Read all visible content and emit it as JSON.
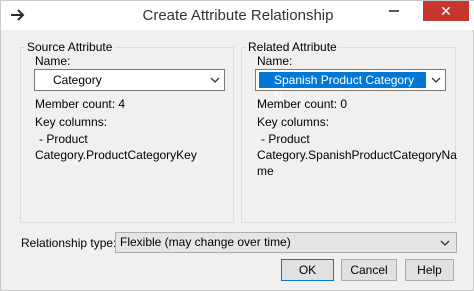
{
  "window": {
    "title": "Create Attribute Relationship",
    "close_glyph": "✕"
  },
  "source": {
    "group_label": "Source Attribute",
    "name_label": "Name:",
    "name_value": "Category",
    "member_count": "Member count: 4",
    "key_columns_label": "Key columns:",
    "key_line1": "- Product",
    "key_line2": "Category.ProductCategoryKey"
  },
  "related": {
    "group_label": "Related Attribute",
    "name_label": "Name:",
    "name_value": "Spanish Product Category N...",
    "member_count": "Member count: 0",
    "key_columns_label": "Key columns:",
    "key_line1": "- Product",
    "key_line2": "Category.SpanishProductCategoryNa",
    "key_line3": "me"
  },
  "relationship": {
    "label": "Relationship type:",
    "value": "Flexible (may change over time)"
  },
  "buttons": {
    "ok": "OK",
    "cancel": "Cancel",
    "help": "Help"
  },
  "colors": {
    "accent": "#0078d7",
    "close": "#c7372f",
    "dialog_bg": "#f0f0f0"
  }
}
